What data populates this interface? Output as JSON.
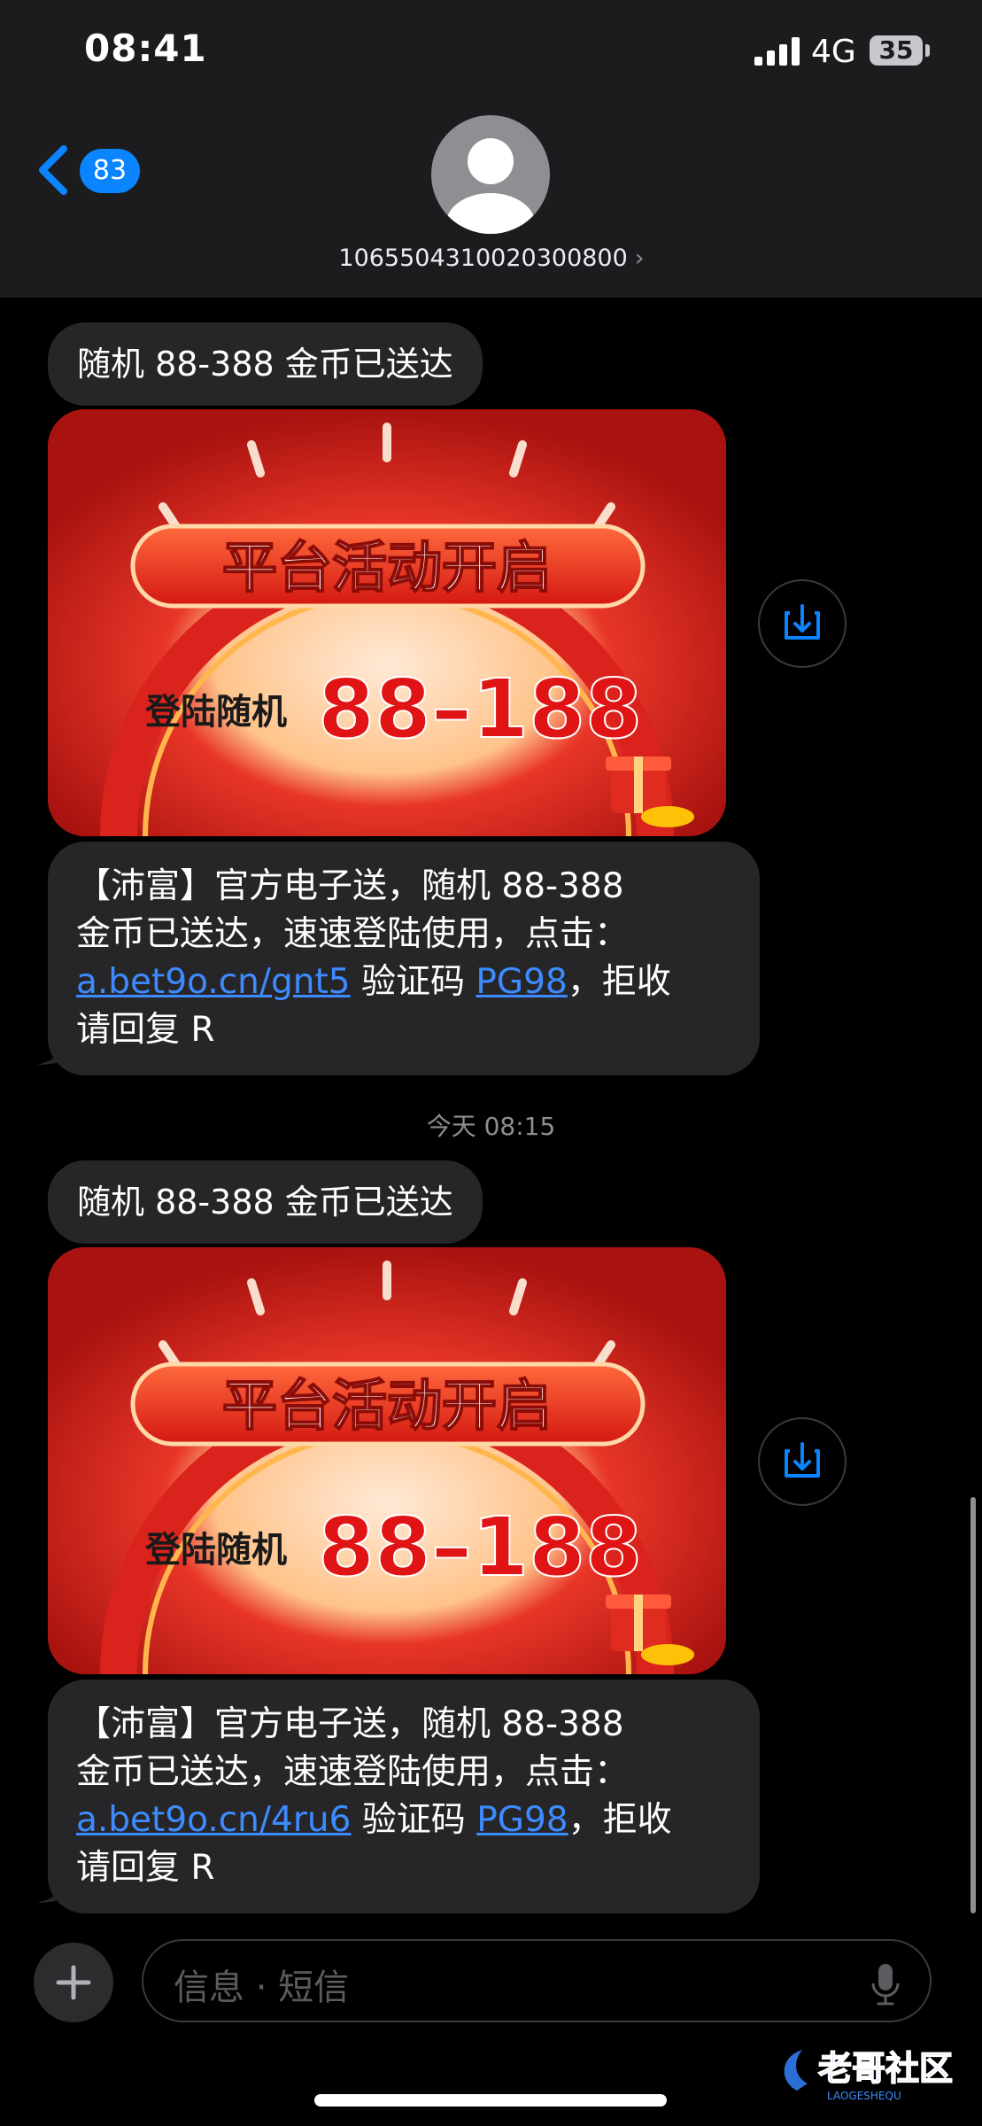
{
  "status_bar": {
    "time": "08:41",
    "network": "4G",
    "battery": "35"
  },
  "nav": {
    "unread_count": "83",
    "contact_number": "1065504310020300800",
    "chevron": "›"
  },
  "messages": [
    {
      "subject": "随机 88-388 金币已送达",
      "image": {
        "banner": "平台活动开启",
        "login_text": "登陆随机",
        "amount": "88–188"
      },
      "body": {
        "line1": "【沛富】官方电子送，随机 88-388",
        "line2": "金币已送达，速速登陆使用，点击：",
        "link": "a.bet9o.cn/gnt5",
        "code_label": " 验证码 ",
        "code": "PG98",
        "tail_text": "，拒收",
        "line4": "请回复 R"
      }
    },
    {
      "subject": "随机 88-388 金币已送达",
      "image": {
        "banner": "平台活动开启",
        "login_text": "登陆随机",
        "amount": "88–188"
      },
      "body": {
        "line1": "【沛富】官方电子送，随机 88-388",
        "line2": "金币已送达，速速登陆使用，点击：",
        "link": "a.bet9o.cn/4ru6",
        "code_label": " 验证码 ",
        "code": "PG98",
        "tail_text": "，拒收",
        "line4": "请回复 R"
      }
    }
  ],
  "timestamp": "今天 08:15",
  "composer": {
    "placeholder": "信息 · 短信"
  },
  "watermark": {
    "text": "老哥社区",
    "sub": "LAOGESHEQU"
  },
  "colors": {
    "accent": "#0a84ff",
    "link": "#3d8bff",
    "bubble": "#262629",
    "header": "#1c1c1e"
  },
  "icons": [
    "back-chevron-icon",
    "contact-avatar-icon",
    "save-icon",
    "plus-icon",
    "microphone-icon",
    "cellular-signal-icon"
  ]
}
